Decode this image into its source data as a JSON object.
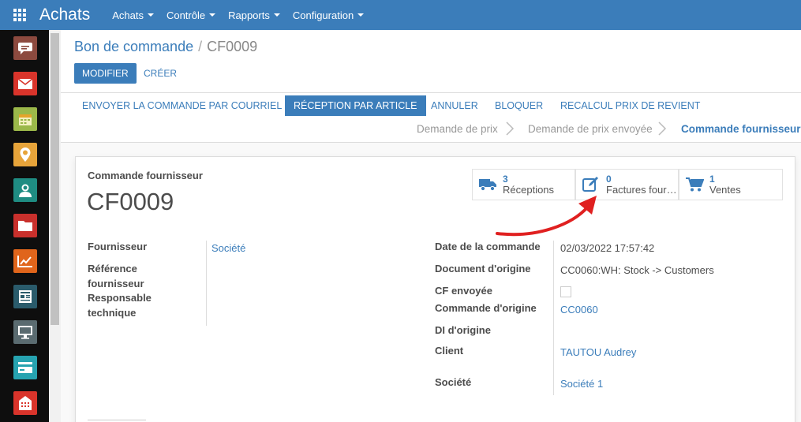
{
  "topbar": {
    "app_name": "Achats",
    "menu": [
      {
        "label": "Achats"
      },
      {
        "label": "Contrôle"
      },
      {
        "label": "Rapports"
      },
      {
        "label": "Configuration"
      }
    ]
  },
  "sidebar_apps": [
    {
      "icon": "discuss-icon",
      "color": "#8c4a3f"
    },
    {
      "icon": "mail-icon",
      "color": "#d9342b"
    },
    {
      "icon": "calendar-icon",
      "color": "#9bb84a"
    },
    {
      "icon": "location-icon",
      "color": "#e7a43a"
    },
    {
      "icon": "contacts-icon",
      "color": "#1f8c82"
    },
    {
      "icon": "folder-icon",
      "color": "#c9302c"
    },
    {
      "icon": "chart-icon",
      "color": "#e0651b"
    },
    {
      "icon": "newspaper-icon",
      "color": "#2a5b6b"
    },
    {
      "icon": "monitor-icon",
      "color": "#5a6b70"
    },
    {
      "icon": "card-icon",
      "color": "#26a3b0"
    },
    {
      "icon": "store-icon",
      "color": "#d9342b"
    }
  ],
  "breadcrumb": {
    "parent": "Bon de commande",
    "separator": "/",
    "current": "CF0009"
  },
  "buttons": {
    "edit": "MODIFIER",
    "create": "CRÉER"
  },
  "header_actions": [
    {
      "label": "ENVOYER LA COMMANDE PAR COURRIEL",
      "active": false
    },
    {
      "label": "RÉCEPTION PAR ARTICLE",
      "active": true
    },
    {
      "label": "ANNULER",
      "active": false
    },
    {
      "label": "BLOQUER",
      "active": false
    },
    {
      "label": "RECALCUL PRIX DE REVIENT",
      "active": false
    }
  ],
  "stages": [
    {
      "label": "Demande de prix",
      "current": false
    },
    {
      "label": "Demande de prix envoyée",
      "current": false
    },
    {
      "label": "Commande fournisseur",
      "current": true
    }
  ],
  "record": {
    "type_label": "Commande fournisseur",
    "name": "CF0009"
  },
  "smart_buttons": [
    {
      "count": "3",
      "label": "Réceptions",
      "icon": "truck-icon"
    },
    {
      "count": "0",
      "label": "Factures four…",
      "icon": "edit-icon"
    },
    {
      "count": "1",
      "label": "Ventes",
      "icon": "cart-icon"
    }
  ],
  "left_fields": {
    "supplier_label": "Fournisseur",
    "supplier_value": "Société",
    "supplier_ref_label": "Référence fournisseur",
    "tech_manager_label": "Responsable technique"
  },
  "right_fields": {
    "order_date_label": "Date de la commande",
    "order_date_value": "02/03/2022 17:57:42",
    "source_doc_label": "Document d'origine",
    "source_doc_value": "CC0060:WH: Stock -> Customers",
    "cf_sent_label": "CF envoyée",
    "origin_order_label": "Commande d'origine",
    "origin_order_value": "CC0060",
    "origin_di_label": "DI d'origine",
    "client_label": "Client",
    "client_value": "TAUTOU Audrey",
    "company_label": "Société",
    "company_value": "Société 1"
  },
  "annotation": {
    "color": "#e02020"
  }
}
